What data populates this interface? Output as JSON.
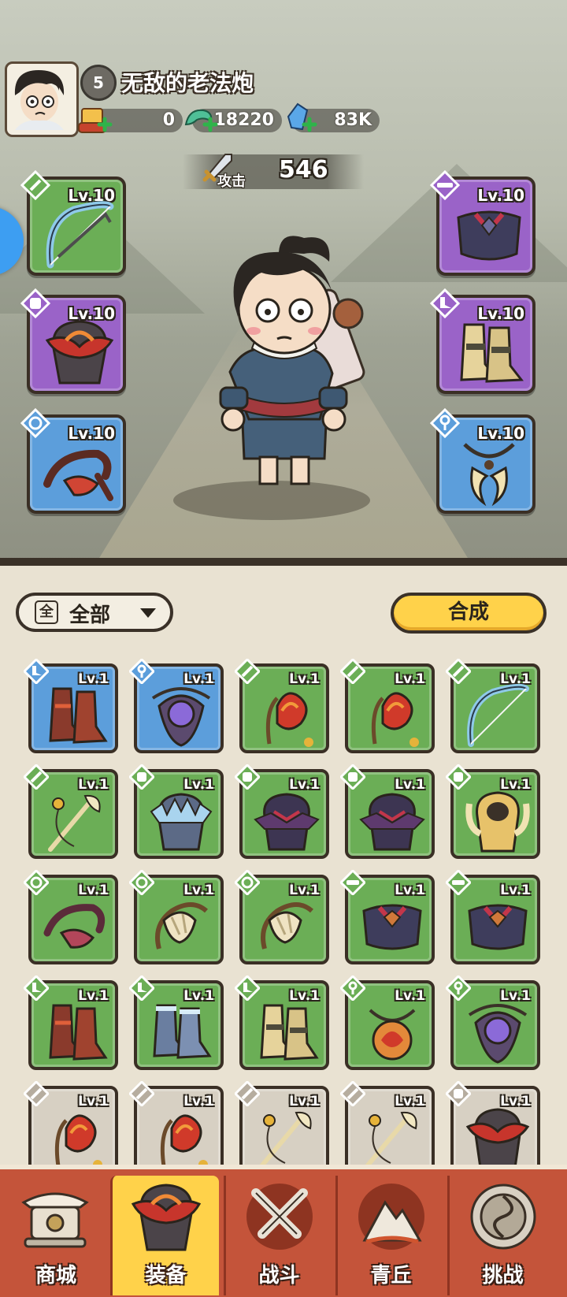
{
  "player": {
    "name": "无敌的老法炮",
    "level": "5"
  },
  "resources": [
    {
      "name": "scroll",
      "value": "0",
      "icon": "scroll-icon"
    },
    {
      "name": "jade",
      "value": "18220",
      "icon": "jade-dragon-icon"
    },
    {
      "name": "crystal",
      "value": "83K",
      "icon": "crystal-icon"
    }
  ],
  "attack": {
    "label": "攻击",
    "value": "546"
  },
  "equipped": [
    {
      "slot": "weapon",
      "level": "Lv.10",
      "rarity": "green",
      "icon": "bow-icon"
    },
    {
      "slot": "helmet",
      "level": "Lv.10",
      "rarity": "purple",
      "icon": "helmet-icon"
    },
    {
      "slot": "bracer",
      "level": "Lv.10",
      "rarity": "blue",
      "icon": "bracer-icon"
    },
    {
      "slot": "belt",
      "level": "Lv.10",
      "rarity": "purple",
      "icon": "belt-icon"
    },
    {
      "slot": "boots",
      "level": "Lv.10",
      "rarity": "purple",
      "icon": "boots-icon"
    },
    {
      "slot": "necklace",
      "level": "Lv.10",
      "rarity": "blue",
      "icon": "necklace-icon"
    }
  ],
  "inventory": {
    "filter_label": "全部",
    "filter_box": "全",
    "synth_label": "合成",
    "items": [
      {
        "level": "Lv.1",
        "rarity": "blue",
        "icon": "boots-icon"
      },
      {
        "level": "Lv.1",
        "rarity": "blue",
        "icon": "amulet-icon"
      },
      {
        "level": "Lv.1",
        "rarity": "green",
        "icon": "flame-bow-icon"
      },
      {
        "level": "Lv.1",
        "rarity": "green",
        "icon": "flame-bow-icon"
      },
      {
        "level": "Lv.1",
        "rarity": "green",
        "icon": "bow-icon"
      },
      {
        "level": "Lv.1",
        "rarity": "green",
        "icon": "staff-bow-icon"
      },
      {
        "level": "Lv.1",
        "rarity": "green",
        "icon": "frost-helmet-icon"
      },
      {
        "level": "Lv.1",
        "rarity": "green",
        "icon": "dark-helmet-icon"
      },
      {
        "level": "Lv.1",
        "rarity": "green",
        "icon": "dark-helmet-icon"
      },
      {
        "level": "Lv.1",
        "rarity": "green",
        "icon": "gold-helmet-icon"
      },
      {
        "level": "Lv.1",
        "rarity": "green",
        "icon": "bracer-icon"
      },
      {
        "level": "Lv.1",
        "rarity": "green",
        "icon": "bone-bracer-icon"
      },
      {
        "level": "Lv.1",
        "rarity": "green",
        "icon": "bone-bracer-icon"
      },
      {
        "level": "Lv.1",
        "rarity": "green",
        "icon": "belt-icon"
      },
      {
        "level": "Lv.1",
        "rarity": "green",
        "icon": "belt-icon"
      },
      {
        "level": "Lv.1",
        "rarity": "green",
        "icon": "boots-icon"
      },
      {
        "level": "Lv.1",
        "rarity": "green",
        "icon": "frost-boots-icon"
      },
      {
        "level": "Lv.1",
        "rarity": "green",
        "icon": "gold-boots-icon"
      },
      {
        "level": "Lv.1",
        "rarity": "green",
        "icon": "orb-necklace-icon"
      },
      {
        "level": "Lv.1",
        "rarity": "green",
        "icon": "amulet-icon"
      },
      {
        "level": "Lv.1",
        "rarity": "gray",
        "icon": "flame-bow-icon"
      },
      {
        "level": "Lv.1",
        "rarity": "gray",
        "icon": "flame-bow-icon"
      },
      {
        "level": "Lv.1",
        "rarity": "gray",
        "icon": "staff-bow-icon"
      },
      {
        "level": "Lv.1",
        "rarity": "gray",
        "icon": "staff-bow-icon"
      },
      {
        "level": "Lv.1",
        "rarity": "gray",
        "icon": "helmet-icon"
      }
    ]
  },
  "nav": [
    {
      "label": "商城",
      "icon": "shop-icon"
    },
    {
      "label": "装备",
      "icon": "helmet-icon"
    },
    {
      "label": "战斗",
      "icon": "crossed-swords-icon"
    },
    {
      "label": "青丘",
      "icon": "mountain-icon"
    },
    {
      "label": "挑战",
      "icon": "challenge-orb-icon"
    }
  ],
  "colors": {
    "green": "#6bae56",
    "blue": "#5c9edb",
    "purple": "#9a63c8",
    "gray": "#d7d0c3",
    "nav_active": "#ffd24a",
    "nav_bg": "#c4543a"
  }
}
